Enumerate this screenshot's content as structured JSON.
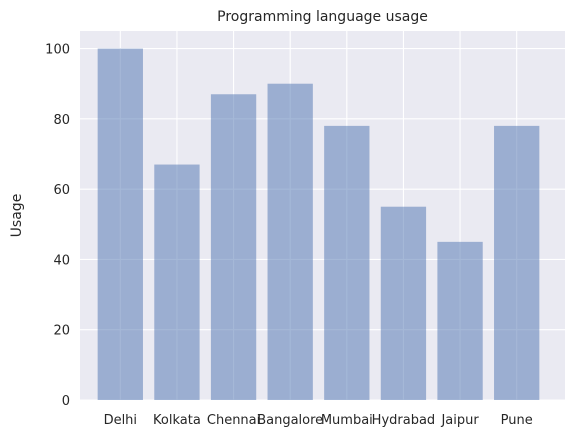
{
  "chart_data": {
    "type": "bar",
    "title": "Programming language usage",
    "xlabel": "",
    "ylabel": "Usage",
    "categories": [
      "Delhi",
      "Kolkata",
      "Chennai",
      "Bangalore",
      "Mumbai",
      "Hydrabad",
      "Jaipur",
      "Pune"
    ],
    "values": [
      100,
      67,
      87,
      90,
      78,
      55,
      45,
      78
    ],
    "ylim": [
      0,
      105
    ],
    "yticks": [
      0,
      20,
      40,
      60,
      80,
      100
    ],
    "grid": true,
    "legend": "none",
    "colors": {
      "bar": "#4c72b0",
      "plot_background": "#eaeaf2",
      "grid": "#ffffff"
    }
  }
}
